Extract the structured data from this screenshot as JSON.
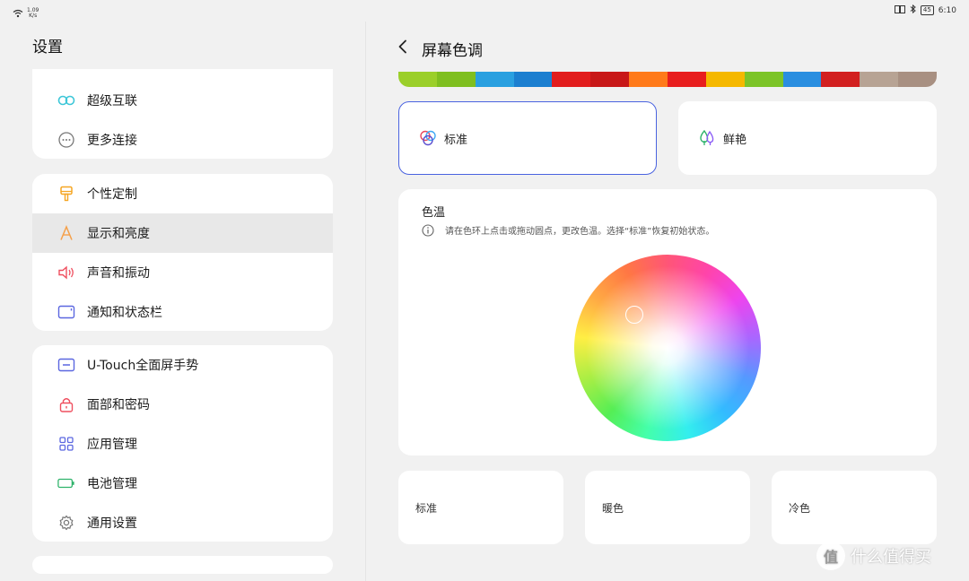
{
  "status_bar": {
    "speed_value": "1.09",
    "speed_unit": "K/s",
    "battery": "45",
    "time": "6:10"
  },
  "sidebar": {
    "title": "设置",
    "groups": [
      {
        "items": [
          {
            "label": "超级互联",
            "icon": "infinity-link-icon"
          },
          {
            "label": "更多连接",
            "icon": "more-dots-icon"
          }
        ]
      },
      {
        "items": [
          {
            "label": "个性定制",
            "icon": "paint-brush-icon"
          },
          {
            "label": "显示和亮度",
            "icon": "display-a-icon",
            "active": true
          },
          {
            "label": "声音和振动",
            "icon": "speaker-icon"
          },
          {
            "label": "通知和状态栏",
            "icon": "notification-icon"
          }
        ]
      },
      {
        "items": [
          {
            "label": "U-Touch全面屏手势",
            "icon": "gesture-icon"
          },
          {
            "label": "面部和密码",
            "icon": "lock-icon"
          },
          {
            "label": "应用管理",
            "icon": "apps-grid-icon"
          },
          {
            "label": "电池管理",
            "icon": "battery-icon"
          },
          {
            "label": "通用设置",
            "icon": "gear-icon"
          }
        ]
      }
    ]
  },
  "main": {
    "title": "屏幕色调",
    "modes": [
      {
        "label": "标准",
        "icon": "rgb-circles-icon",
        "selected": true
      },
      {
        "label": "鲜艳",
        "icon": "vivid-drops-icon",
        "selected": false
      }
    ],
    "color_temp": {
      "title": "色温",
      "hint": "请在色环上点击或拖动圆点，更改色温。选择“标准”恢复初始状态。"
    },
    "presets": [
      "标准",
      "暖色",
      "冷色"
    ]
  },
  "watermark": {
    "text": "什么值得买",
    "logo_char": "值"
  },
  "colors": {
    "accent": "#4a63e0",
    "background": "#f1f1f1",
    "card": "#ffffff",
    "active_row": "#e8e8e8"
  }
}
